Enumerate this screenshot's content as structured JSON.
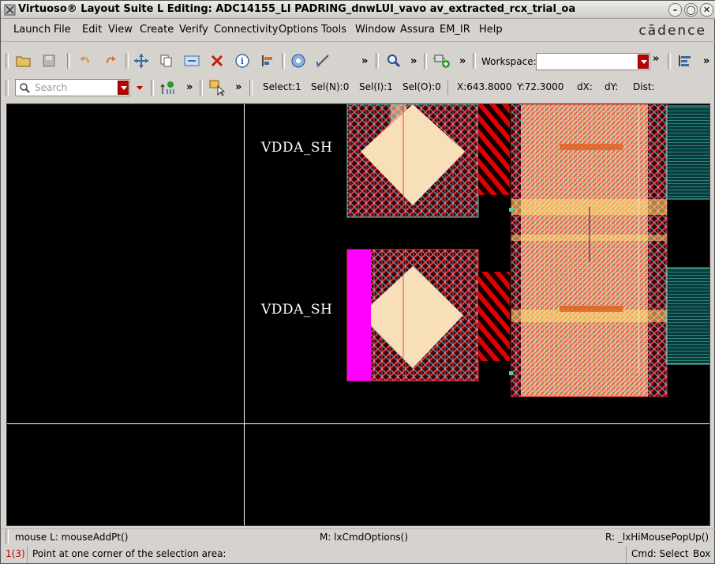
{
  "window": {
    "title": "Virtuoso® Layout Suite L Editing: ADC14155_LI PADRING_dnwLUI_vavo av_extracted_rcx_trial_oa"
  },
  "menu": {
    "items": [
      "Launch",
      "File",
      "Edit",
      "View",
      "Create",
      "Verify",
      "Connectivity",
      "Options",
      "Tools",
      "Window",
      "Assura",
      "EM_IR",
      "Help"
    ],
    "brand": "cādence"
  },
  "toolbar": {
    "more": "»",
    "workspace_label": "Workspace:",
    "workspace_value": "",
    "search_placeholder": "Search"
  },
  "status": {
    "select": "Select:1",
    "sel_n": "Sel(N):0",
    "sel_i": "Sel(I):1",
    "sel_o": "Sel(O):0",
    "x": "X:643.8000",
    "y": "Y:72.3000",
    "dx": "dX:",
    "dy": "dY:",
    "dist": "Dist:"
  },
  "canvas": {
    "labels": [
      "VDDA_SH",
      "VDDA_SH"
    ],
    "colors": {
      "pad_fill": "#f7dfb9",
      "metal_red": "#d40000",
      "magenta": "#ff00ff",
      "cyan": "#45d3c0",
      "yellow": "#ffe070"
    }
  },
  "mousebar": {
    "left": "mouse L: mouseAddPt()",
    "middle": "M: lxCmdOptions()",
    "right": "R: _lxHiMousePopUp()"
  },
  "statusbar": {
    "count": "1(3)",
    "prompt": "Point at one corner of the selection area:",
    "cmd": "Cmd: Select",
    "mode": "Box"
  }
}
